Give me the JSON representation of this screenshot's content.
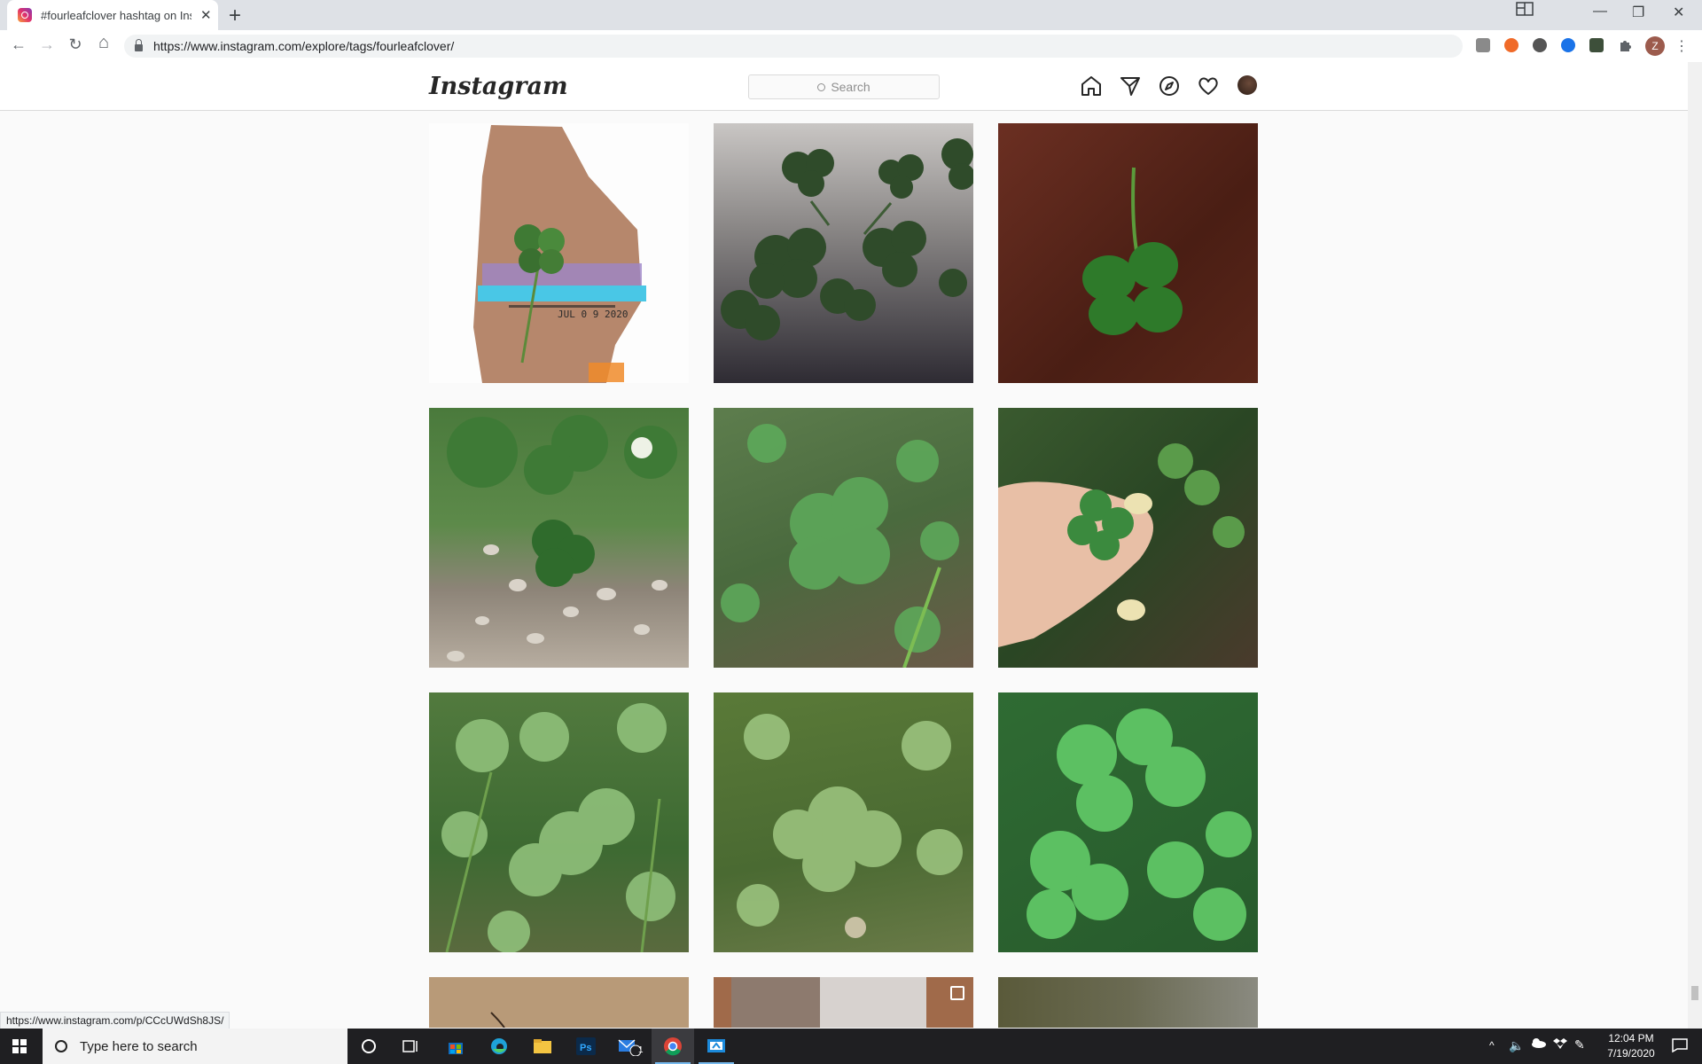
{
  "browser": {
    "tab_title": "#fourleafclover hashtag on Instagram",
    "tab_close": "✕",
    "new_tab": "+",
    "url": "https://www.instagram.com/explore/tags/fourleafclover/",
    "profile_initial": "Z",
    "status_url": "https://www.instagram.com/p/CCcUWdSh8JS/",
    "window_controls": {
      "minimize": "—",
      "maximize": "❐",
      "close": "✕"
    },
    "nav": {
      "back": "←",
      "forward": "→",
      "reload": "↻",
      "home": "⌂"
    }
  },
  "instagram": {
    "logo": "Instagram",
    "search_placeholder": "Search",
    "nav_icons": [
      "home-icon",
      "direct-icon",
      "explore-icon",
      "activity-icon",
      "profile-avatar"
    ]
  },
  "grid": {
    "tiles": [
      {
        "name": "clover-collage-jul-09-2020",
        "stamp_text": "JUL 0 9 2020"
      },
      {
        "name": "clovers-on-table"
      },
      {
        "name": "clover-on-wood"
      },
      {
        "name": "clover-in-gravel"
      },
      {
        "name": "clover-patch-leaves"
      },
      {
        "name": "clover-in-hand"
      },
      {
        "name": "clover-in-grass"
      },
      {
        "name": "clover-field"
      },
      {
        "name": "bright-clovers"
      },
      {
        "name": "partial-tile-1"
      },
      {
        "name": "partial-tile-2",
        "multi_post": true
      },
      {
        "name": "partial-tile-3"
      }
    ]
  },
  "taskbar": {
    "search_placeholder": "Type here to search",
    "time": "12:04 PM",
    "date": "7/19/2020",
    "mail_badge": "1"
  },
  "colors": {
    "accent_instagram": "#262626",
    "border": "#dbdbdb",
    "taskbar_bg": "#1f1f22"
  }
}
